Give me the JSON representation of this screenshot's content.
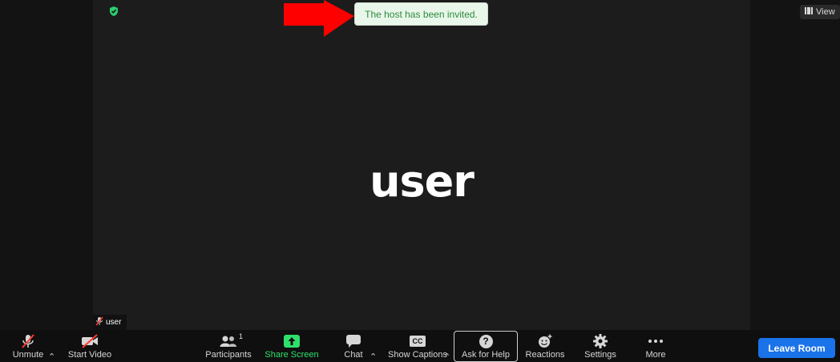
{
  "notification": {
    "text": "The host has been invited."
  },
  "view_button": {
    "label": "View"
  },
  "participant": {
    "display_name": "user",
    "name_tag": "user"
  },
  "toolbar": {
    "unmute": "Unmute",
    "start_video": "Start Video",
    "participants": "Participants",
    "participants_count": "1",
    "share_screen": "Share Screen",
    "chat": "Chat",
    "show_captions": "Show Captions",
    "cc_icon_text": "CC",
    "ask_for_help": "Ask for Help",
    "help_icon_text": "?",
    "reactions": "Reactions",
    "settings": "Settings",
    "more": "More",
    "leave_room": "Leave Room"
  },
  "colors": {
    "stage_bg": "#1c1c1c",
    "toast_bg": "#e8f7ea",
    "toast_text": "#2f8a3c",
    "share_green": "#2ee06b",
    "leave_blue": "#1a73e8",
    "arrow_red": "#ff0000"
  },
  "icons": [
    "shield-icon",
    "view-icon",
    "mic-muted-icon",
    "video-off-icon",
    "participants-icon",
    "share-screen-icon",
    "chat-icon",
    "captions-icon",
    "help-icon",
    "reactions-icon",
    "settings-icon",
    "more-icon",
    "arrow-icon"
  ]
}
